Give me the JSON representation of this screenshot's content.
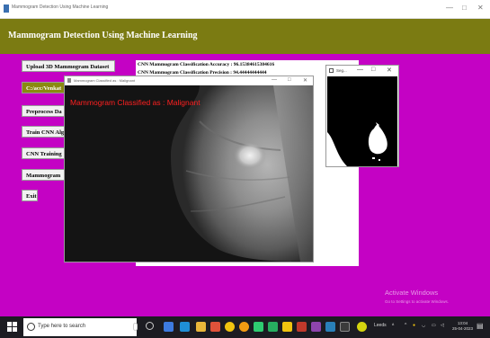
{
  "window": {
    "title": "Mammogram Detection Using Machine Learning",
    "controls": [
      "—",
      "□",
      "✕"
    ]
  },
  "header": {
    "title": "Mammogram Detection Using Machine Learning"
  },
  "buttons": [
    {
      "label": "Upload 3D Mammogram Dataset"
    },
    {
      "label": "C:/acc/Venkat"
    },
    {
      "label": "Preprocess Da"
    },
    {
      "label": "Train CNN Alg"
    },
    {
      "label": "CNN Training"
    },
    {
      "label": "Mammogram"
    },
    {
      "label": "Exit"
    }
  ],
  "results": {
    "line1": "CNN Mammogram Classification Accuracy : 96.15384615384616",
    "line2": "CNN Mammogram Classification Precision : 94.44444444444"
  },
  "image_window": {
    "title": "Mammogram Classified as : Malignant",
    "caption": "Mammogram Classified as : Malignant",
    "controls": [
      "—",
      "□",
      "✕"
    ]
  },
  "seg_window": {
    "title": "Seg...",
    "controls": [
      "—",
      "□",
      "✕"
    ]
  },
  "watermark": {
    "line1": "Activate Windows",
    "line2": "Go to Settings to activate Windows."
  },
  "taskbar": {
    "search_placeholder": "Type here to search",
    "tray_text": "Leeds",
    "time": "13:04",
    "date": "25-04-2023"
  },
  "colors": {
    "background": "#c402c4",
    "header": "#7b7b12",
    "caption": "#ff2020"
  }
}
